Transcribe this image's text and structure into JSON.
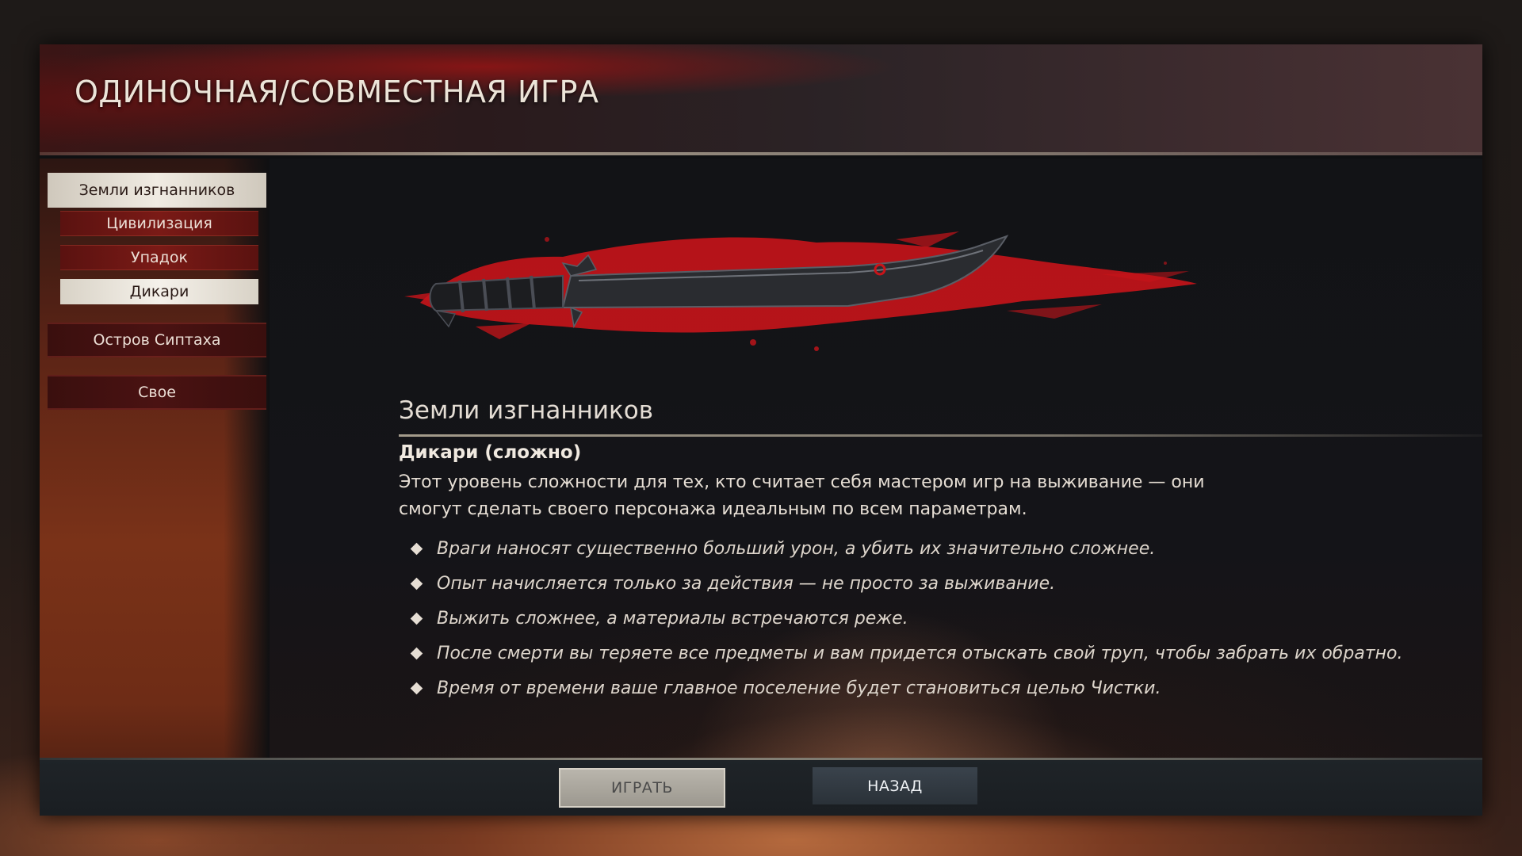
{
  "header": {
    "title": "ОДИНОЧНАЯ/СОВМЕСТНАЯ ИГРА"
  },
  "sidebar": {
    "items": [
      {
        "label": "Земли изгнанников",
        "level": "primary",
        "selected": true
      },
      {
        "label": "Цивилизация",
        "level": "sub",
        "selected": false
      },
      {
        "label": "Упадок",
        "level": "sub",
        "selected": false
      },
      {
        "label": "Дикари",
        "level": "sub",
        "selected": true
      },
      {
        "label": "Остров Сиптаха",
        "level": "primary",
        "selected": false
      },
      {
        "label": "Свое",
        "level": "primary",
        "selected": false
      }
    ]
  },
  "details": {
    "mode_title": "Земли изгнанников",
    "difficulty_title": "Дикари (сложно)",
    "description": "Этот уровень сложности для тех, кто считает себя мастером игр на выживание — они смогут сделать своего персонажа идеальным по всем параметрам.",
    "features": [
      "Враги наносят существенно больший урон, а убить их значительно сложнее.",
      "Опыт начисляется только за действия — не просто за выживание.",
      "Выжить сложнее, а материалы встречаются реже.",
      "После смерти вы теряете все предметы и вам придется отыскать свой труп, чтобы забрать их обратно.",
      "Время от времени ваше главное поселение будет становиться целью Чистки."
    ]
  },
  "footer": {
    "play_label": "ИГРАТЬ",
    "back_label": "НАЗАД"
  },
  "art": {
    "icon": "knife-icon",
    "splatter_color": "#c8141a",
    "blade_color": "#2a2c30"
  }
}
